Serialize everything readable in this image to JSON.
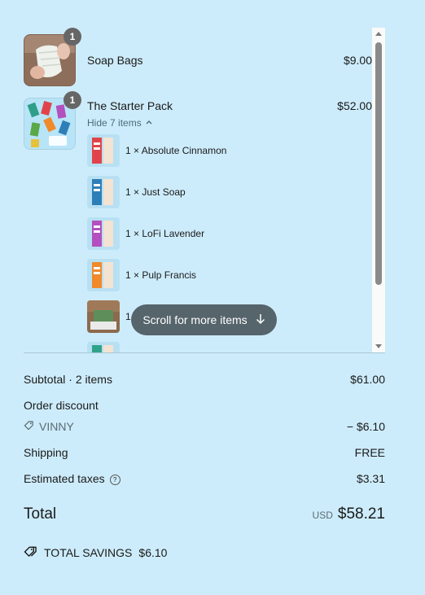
{
  "cart": {
    "items": [
      {
        "name": "Soap Bags",
        "price": "$9.00",
        "qty_badge": "1"
      },
      {
        "name": "The Starter Pack",
        "price": "$52.00",
        "qty_badge": "1",
        "toggle_label": "Hide 7 items",
        "sub_items": [
          {
            "label": "1 × Absolute Cinnamon",
            "color": "#e0444a"
          },
          {
            "label": "1 × Just Soap",
            "color": "#2e7fb8"
          },
          {
            "label": "1 × LoFi Lavender",
            "color": "#b34fbe"
          },
          {
            "label": "1 × Pulp Francis",
            "color": "#f08a2a"
          },
          {
            "label": "1",
            "color": "#5e8f5a"
          },
          {
            "label": "",
            "color": "#2fa38a"
          }
        ]
      }
    ],
    "scroll_hint": "Scroll for more items"
  },
  "summary": {
    "subtotal_label": "Subtotal · 2 items",
    "subtotal_value": "$61.00",
    "discount_label": "Order discount",
    "discount_code": "VINNY",
    "discount_value": "− $6.10",
    "shipping_label": "Shipping",
    "shipping_value": "FREE",
    "taxes_label": "Estimated taxes",
    "taxes_value": "$3.31",
    "total_label": "Total",
    "currency": "USD",
    "total_value": "$58.21",
    "savings_label": "TOTAL SAVINGS",
    "savings_value": "$6.10"
  },
  "icons": {
    "tag": "tag-icon",
    "help": "question-circle-icon",
    "chevron": "chevron-up-icon",
    "arrow": "arrow-down-icon"
  }
}
